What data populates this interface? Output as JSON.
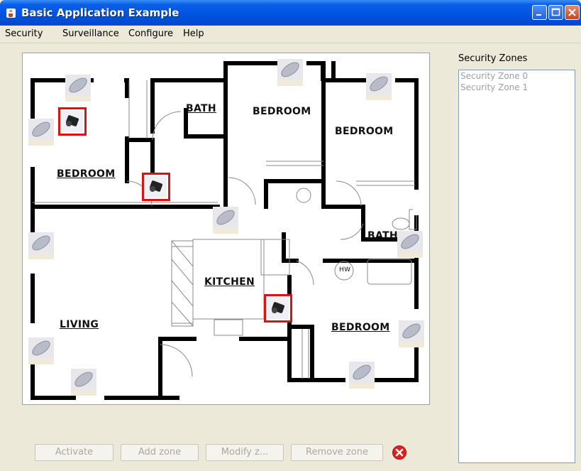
{
  "window": {
    "title": "Basic Application Example"
  },
  "menu": [
    "Security",
    "Surveillance",
    "Configure",
    "Help"
  ],
  "floorplan": {
    "rooms": [
      {
        "label": "BATH"
      },
      {
        "label": "BEDROOM"
      },
      {
        "label": "BEDROOM"
      },
      {
        "label": "BEDROOM"
      },
      {
        "label": "BATH"
      },
      {
        "label": "KITCHEN"
      },
      {
        "label": "HW"
      },
      {
        "label": "LIVING"
      },
      {
        "label": "BEDROOM"
      }
    ],
    "cameras_active": 3,
    "cameras_idle": 11
  },
  "zones": {
    "title": "Security Zones",
    "items": [
      "Security Zone 0",
      "Security Zone 1"
    ]
  },
  "buttons": {
    "activate": "Activate",
    "add_zone": "Add zone",
    "modify_zone": "Modify z...",
    "remove_zone": "Remove zone"
  },
  "colors": {
    "title_bar": "#0054e3",
    "active_camera_border": "#e01010",
    "disabled_text": "#aca899"
  },
  "icons": {
    "app": "java-cup-icon",
    "cancel": "red-x-circle-icon",
    "camera_idle": "camera-lens-icon",
    "camera_active": "camera-active-icon"
  }
}
